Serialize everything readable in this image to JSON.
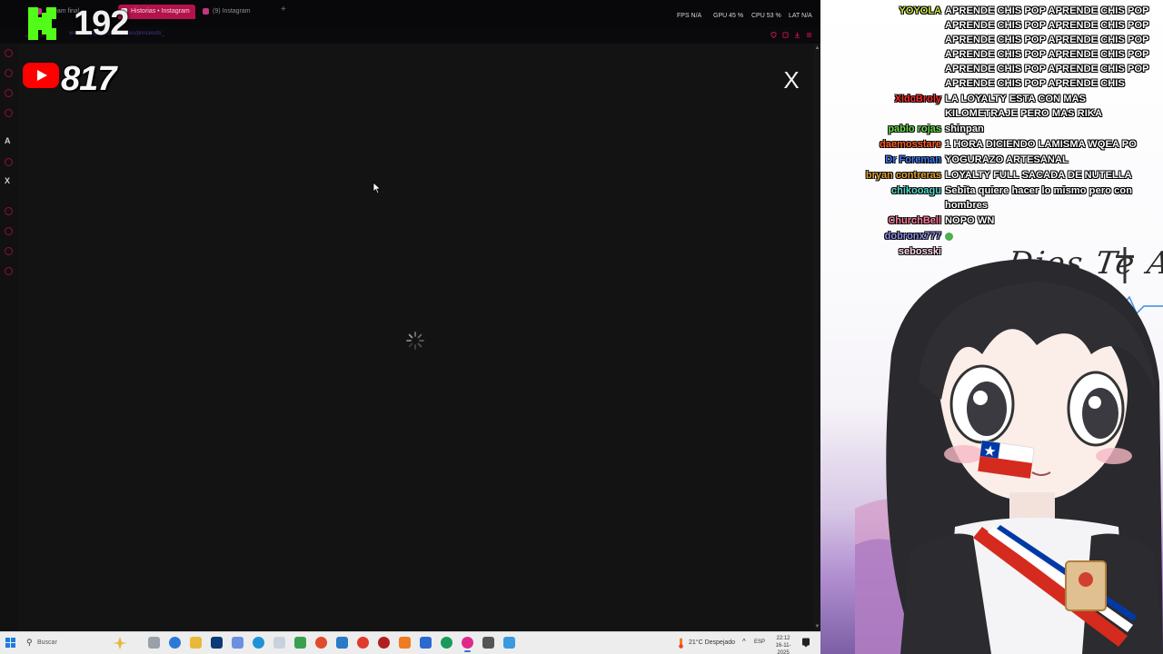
{
  "browser": {
    "tabs": [
      {
        "label": "Stream final"
      },
      {
        "label": "Historias • Instagram"
      },
      {
        "label": "(9) Instagram"
      }
    ],
    "new_tab_label": "+",
    "url": "www.instagram.com/stories/princesstv_",
    "stats": {
      "fps": "FPS N/A",
      "gpu": "GPU 45 %",
      "cpu": "CPU 53 %",
      "lat": "LAT N/A"
    },
    "close_label": "X",
    "sidebar_glyphs": [
      "A",
      "X"
    ]
  },
  "overlay": {
    "kick_count": "192",
    "youtube_count": "817",
    "kick_color": "#53fc18",
    "youtube_color": "#ff0000"
  },
  "taskbar": {
    "search_placeholder": "Buscar",
    "weather": "21°C  Despejado",
    "tray_arrow": "^",
    "language": "ESP",
    "time": "22:12",
    "date": "16-11-2025"
  },
  "chat": {
    "messages": [
      {
        "user": "YOYOLA",
        "color": "#c9e33a",
        "text": "APRENDE CHIS POP APRENDE CHIS POP APRENDE CHIS POP APRENDE CHIS POP APRENDE CHIS POP APRENDE CHIS POP APRENDE CHIS POP APRENDE CHIS POP APRENDE CHIS POP APRENDE CHIS POP APRENDE CHIS POP APRENDE CHIS"
      },
      {
        "user": "XIdcBroly",
        "color": "#ff2a2a",
        "text": "LA LOYALTY ESTA CON MAS KILOMETRAJE PERO MAS RIKA"
      },
      {
        "user": "pablo rojas",
        "color": "#6be04b",
        "text": "shinpan"
      },
      {
        "user": "daemosstare",
        "color": "#ff5a1f",
        "text": "1 HORA DICIENDO LAMISMA WQEA PO"
      },
      {
        "user": "Dr Foreman",
        "color": "#3d7bff",
        "text": "YOGURAZO ARTESANAL"
      },
      {
        "user": "bryan contreras",
        "color": "#e0a030",
        "text": "LOYALTY FULL SACADA DE NUTELLA"
      },
      {
        "user": "chikooagu",
        "color": "#4fd8c8",
        "text": "Sebita quiere hacer lo mismo pero con hombres"
      },
      {
        "user": "ChurchBell",
        "color": "#ff7b9c",
        "text": "NOPO WN"
      },
      {
        "user": "dobronx777",
        "color": "#8a8ef0",
        "text": ""
      },
      {
        "user": "sebosski",
        "color": "#ffd6ea",
        "text": ""
      }
    ]
  },
  "background_art": {
    "caption": "Dios Te A"
  }
}
